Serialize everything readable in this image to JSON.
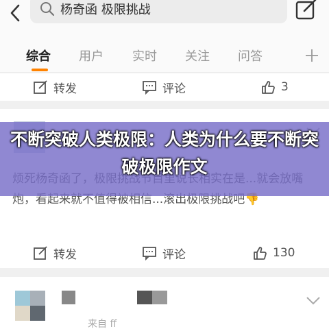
{
  "search": {
    "query": "杨奇函 极限挑战"
  },
  "tabs": [
    {
      "label": "综合"
    },
    {
      "label": "用户"
    },
    {
      "label": "实时"
    },
    {
      "label": "关注"
    },
    {
      "label": "问答"
    }
  ],
  "post1": {
    "repost_label": "转发",
    "comment_label": "评论",
    "like_count": "3"
  },
  "post2": {
    "text": "烦死杨奇函了，极限挑战节目里说长相实在是...就会放嘴炮，看起来就不值得被相信...滚出极限挑战吧👎",
    "repost_label": "转发",
    "comment_label": "评论",
    "like_count": "130"
  },
  "post3": {
    "author_fragment": "来自 ff"
  },
  "banner": {
    "title": "不断突破人类极限：人类为什么要不断突破极限作文"
  },
  "colors": {
    "accent": "#ff8200",
    "banner": "#786ec8"
  }
}
